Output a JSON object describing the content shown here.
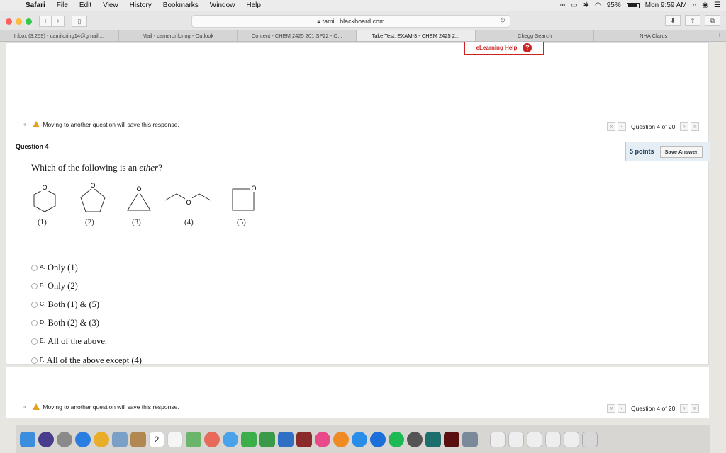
{
  "menubar": {
    "app": "Safari",
    "items": [
      "File",
      "Edit",
      "View",
      "History",
      "Bookmarks",
      "Window",
      "Help"
    ],
    "battery": "95%",
    "clock": "Mon 9:59 AM"
  },
  "toolbar": {
    "url": "tamiu.blackboard.com"
  },
  "tabs": [
    "Inbox (3,259) - camiloring14@gmail....",
    "Mail - cameronloring - Outlook",
    "Content - CHEM 2425 201 SP22 - O...",
    "Take Test: EXAM-3 - CHEM 2425 2...",
    "Chegg Search",
    "NHA Clarus"
  ],
  "help": {
    "label": "eLearning Help",
    "icon": "?"
  },
  "warning_text": "Moving to another question will save this response.",
  "qnav": {
    "label": "Question 4 of 20"
  },
  "question": {
    "header": "Question 4",
    "points": "5 points",
    "save_label": "Save Answer",
    "text_before": "Which of the following is an ",
    "text_emph": "ether",
    "text_after": "?",
    "mol_labels": [
      "(1)",
      "(2)",
      "(3)",
      "(4)",
      "(5)"
    ],
    "atom_label": "O",
    "options": [
      {
        "letter": "A.",
        "text": "Only (1)"
      },
      {
        "letter": "B.",
        "text": "Only (2)"
      },
      {
        "letter": "C.",
        "text": "Both (1) & (5)"
      },
      {
        "letter": "D.",
        "text": "Both (2) & (3)"
      },
      {
        "letter": "E.",
        "text": "All of the above."
      },
      {
        "letter": "F.",
        "text": "All of the above except (4)"
      }
    ]
  },
  "colors": {
    "accent": "#c22222",
    "warning": "#e3a21a",
    "points_bg": "#e5eef5"
  },
  "dock": {
    "calendar_day": "2",
    "icons": [
      "finder",
      "siri",
      "launchpad",
      "safari",
      "chrome",
      "mail",
      "notes",
      "calendar",
      "reminders",
      "maps",
      "photos",
      "messages",
      "facetime",
      "numbers",
      "keynote",
      "photo-booth",
      "itunes",
      "ibooks",
      "app-store",
      "system-preferences",
      "spotify",
      "activity-monitor",
      "adobe",
      "preview",
      "trash"
    ]
  }
}
